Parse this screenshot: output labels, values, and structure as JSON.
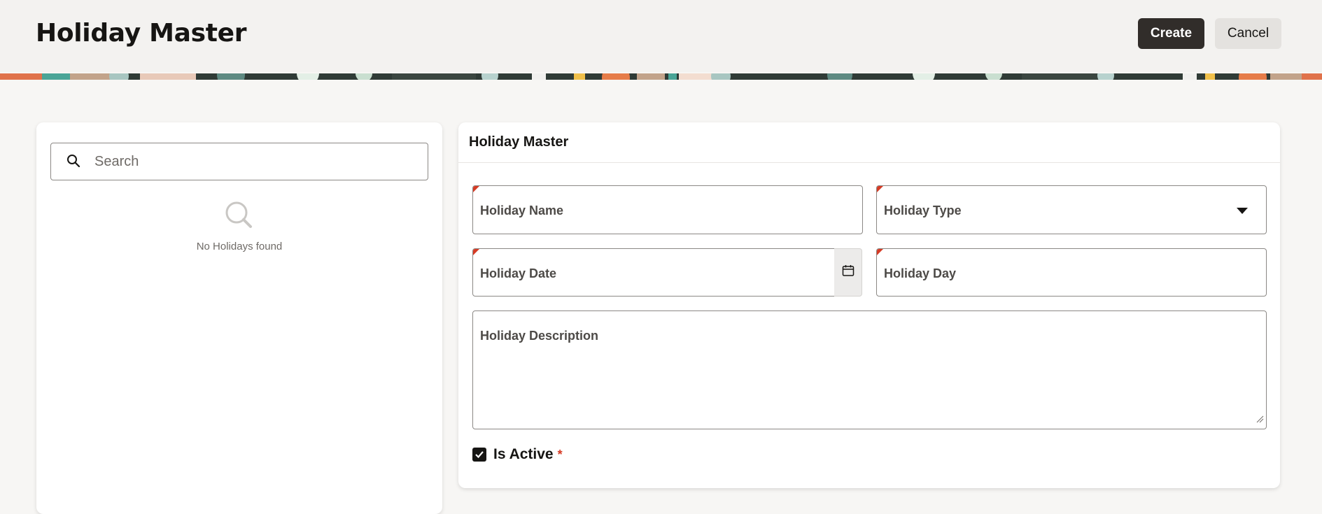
{
  "header": {
    "title": "Holiday Master",
    "create_label": "Create",
    "cancel_label": "Cancel"
  },
  "left_panel": {
    "search": {
      "placeholder": "Search",
      "value": ""
    },
    "empty_state": {
      "icon": "search-icon",
      "message": "No Holidays found"
    }
  },
  "form": {
    "title": "Holiday Master",
    "fields": {
      "holiday_name": {
        "label": "Holiday Name",
        "required": true,
        "value": ""
      },
      "holiday_type": {
        "label": "Holiday Type",
        "required": true,
        "value": "",
        "icon": "chevron-down-icon"
      },
      "holiday_date": {
        "label": "Holiday Date",
        "required": true,
        "value": "",
        "icon": "calendar-icon"
      },
      "holiday_day": {
        "label": "Holiday Day",
        "required": true,
        "value": ""
      },
      "holiday_description": {
        "label": "Holiday Description",
        "value": ""
      }
    },
    "is_active": {
      "label": "Is Active",
      "required_marker": "*",
      "checked": true
    }
  },
  "colors": {
    "primary_button": "#312d2a",
    "secondary_button": "#e4e2df",
    "required_marker": "#d63b25",
    "page_background": "#f7f6f4"
  }
}
